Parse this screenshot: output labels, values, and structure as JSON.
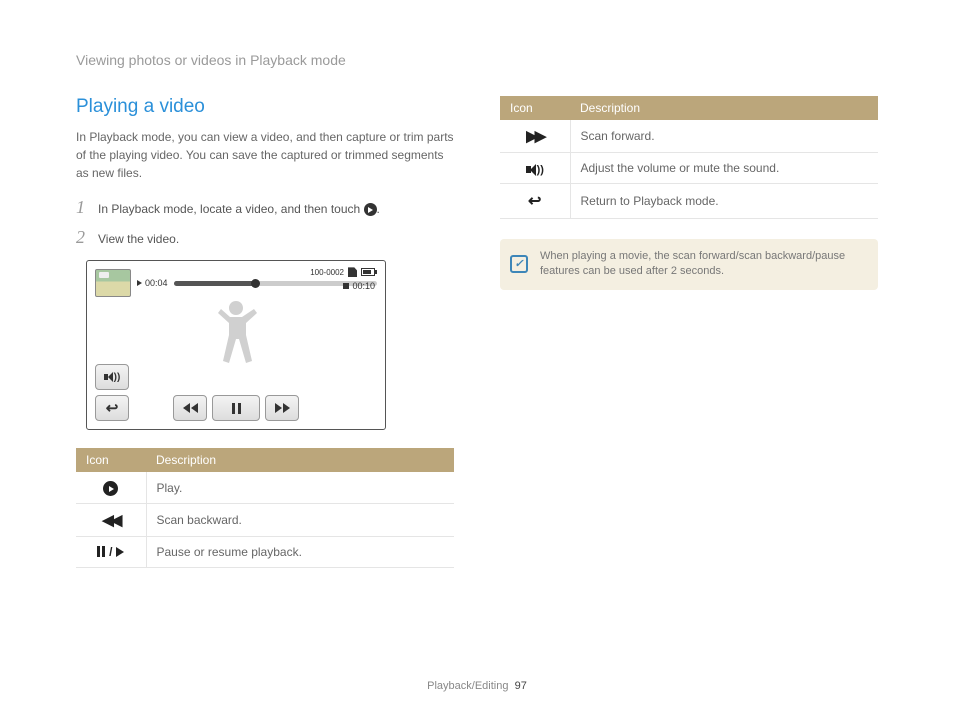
{
  "header": "Viewing photos or videos in Playback mode",
  "title": "Playing a video",
  "intro": "In Playback mode, you can view a video, and then capture or trim parts of the playing video. You can save the captured or trimmed segments as new files.",
  "steps": [
    {
      "num": "1",
      "text_before": "In Playback mode, locate a video, and then touch ",
      "text_after": "."
    },
    {
      "num": "2",
      "text_before": "View the video.",
      "text_after": ""
    }
  ],
  "screenshot": {
    "elapsed": "00:04",
    "duration": "00:10",
    "file_counter": "100-0002"
  },
  "table_header": {
    "icon": "Icon",
    "desc": "Description"
  },
  "table_left": [
    {
      "icon": "play-circle",
      "desc": "Play."
    },
    {
      "icon": "rewind",
      "desc": "Scan backward."
    },
    {
      "icon": "pause-play",
      "desc": "Pause or resume playback."
    }
  ],
  "table_right": [
    {
      "icon": "forward",
      "desc": "Scan forward."
    },
    {
      "icon": "sound",
      "desc": "Adjust the volume or mute the sound."
    },
    {
      "icon": "return",
      "desc": "Return to Playback mode."
    }
  ],
  "note": "When playing a movie, the scan forward/scan backward/pause features can be used after 2 seconds.",
  "footer": {
    "section": "Playback/Editing",
    "page": "97"
  }
}
